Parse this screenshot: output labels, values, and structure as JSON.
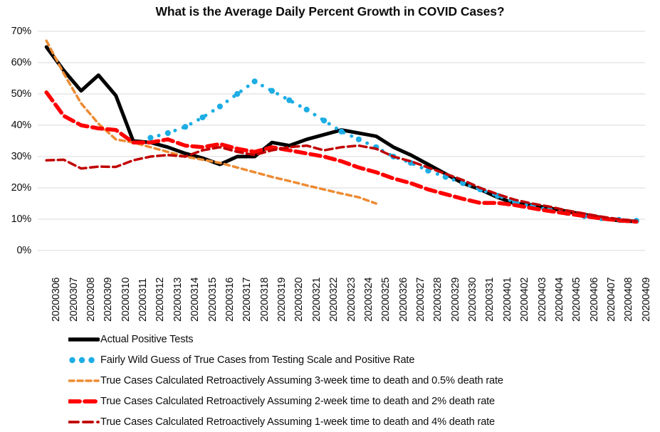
{
  "chart_data": {
    "type": "line",
    "title": "What is the Average Daily Percent Growth in COVID Cases?",
    "xlabel": "",
    "ylabel": "",
    "ylim": [
      0,
      0.7
    ],
    "ytick_labels": [
      "0%",
      "10%",
      "20%",
      "30%",
      "40%",
      "50%",
      "60%",
      "70%"
    ],
    "ytick_values": [
      0,
      0.1,
      0.2,
      0.3,
      0.4,
      0.5,
      0.6,
      0.7
    ],
    "grid": "horizontal",
    "legend_position": "bottom-left",
    "categories": [
      "20200306",
      "20200307",
      "20200308",
      "20200309",
      "20200310",
      "20200311",
      "20200312",
      "20200313",
      "20200314",
      "20200315",
      "20200316",
      "20200317",
      "20200318",
      "20200319",
      "20200320",
      "20200321",
      "20200322",
      "20200323",
      "20200324",
      "20200325",
      "20200326",
      "20200327",
      "20200328",
      "20200329",
      "20200330",
      "20200331",
      "20200401",
      "20200402",
      "20200403",
      "20200404",
      "20200405",
      "20200406",
      "20200407",
      "20200408",
      "20200409"
    ],
    "series": [
      {
        "name": "Actual Positive Tests",
        "color": "#000000",
        "style": "solid",
        "width": 5,
        "marker": "none",
        "values": [
          0.65,
          0.575,
          0.51,
          0.56,
          0.495,
          0.35,
          0.345,
          0.33,
          0.31,
          0.295,
          0.275,
          0.3,
          0.3,
          0.345,
          0.335,
          0.355,
          0.37,
          0.385,
          0.375,
          0.365,
          0.33,
          0.305,
          0.275,
          0.245,
          0.215,
          0.195,
          0.17,
          0.15,
          0.145,
          0.135,
          0.125,
          0.115,
          0.105,
          0.095,
          0.093
        ]
      },
      {
        "name": "Fairly Wild Guess of True Cases from Testing Scale and Positive Rate",
        "color": "#1CADE4",
        "style": "dotted",
        "width": 5,
        "marker": "circle",
        "values": [
          null,
          null,
          null,
          null,
          null,
          null,
          0.36,
          0.375,
          0.395,
          0.425,
          0.46,
          0.5,
          0.54,
          0.51,
          0.48,
          0.45,
          0.415,
          0.38,
          0.355,
          0.33,
          0.3,
          0.28,
          0.255,
          0.235,
          0.215,
          0.195,
          0.175,
          0.155,
          0.14,
          0.13,
          0.12,
          0.11,
          0.103,
          0.098,
          0.095
        ]
      },
      {
        "name": "True Cases Calculated Retroactively Assuming 3-week time to death and 0.5% death rate",
        "color": "#ED8B33",
        "style": "dashed-small",
        "width": 3.5,
        "marker": "none",
        "values": [
          0.67,
          0.565,
          0.47,
          0.405,
          0.355,
          0.345,
          0.33,
          0.315,
          0.3,
          0.29,
          0.28,
          0.265,
          0.25,
          0.235,
          0.222,
          0.208,
          0.195,
          0.182,
          0.17,
          0.15,
          null,
          null,
          null,
          null,
          null,
          null,
          null,
          null,
          null,
          null,
          null,
          null,
          null,
          null,
          null
        ]
      },
      {
        "name": "True Cases Calculated Retroactively Assuming 2-week time to death and 2% death rate",
        "color": "#FF0000",
        "style": "dashed-large",
        "width": 5.5,
        "marker": "none",
        "values": [
          0.505,
          0.43,
          0.4,
          0.39,
          0.385,
          0.345,
          0.345,
          0.355,
          0.335,
          0.33,
          0.34,
          0.325,
          0.315,
          0.33,
          0.32,
          0.31,
          0.3,
          0.285,
          0.265,
          0.25,
          0.23,
          0.215,
          0.195,
          0.18,
          0.165,
          0.152,
          0.152,
          0.145,
          0.135,
          0.126,
          0.118,
          0.11,
          0.102,
          0.096,
          0.092
        ]
      },
      {
        "name": "True Cases Calculated Retroactively Assuming 1-week time to death and 4% death rate",
        "color": "#C00000",
        "style": "dashed-med",
        "width": 3.5,
        "marker": "none",
        "values": [
          0.288,
          0.29,
          0.262,
          0.268,
          0.267,
          0.288,
          0.3,
          0.305,
          0.3,
          0.32,
          0.33,
          0.315,
          0.305,
          0.32,
          0.33,
          0.335,
          0.32,
          0.33,
          0.335,
          0.325,
          0.3,
          0.285,
          0.265,
          0.245,
          0.225,
          0.2,
          0.18,
          0.162,
          0.15,
          0.14,
          0.128,
          0.118,
          0.108,
          0.1,
          0.095
        ]
      }
    ]
  },
  "legend": {
    "items": [
      {
        "label": "Actual Positive Tests",
        "swatch": "solid-black-line"
      },
      {
        "label": "Fairly Wild Guess of True Cases from Testing Scale and Positive Rate",
        "swatch": "dotted-blue-line"
      },
      {
        "label": "True Cases Calculated Retroactively Assuming 3-week time to death and 0.5% death rate",
        "swatch": "dashed-orange-line"
      },
      {
        "label": "True Cases Calculated Retroactively Assuming 2-week time to death and 2% death rate",
        "swatch": "dashed-red-line"
      },
      {
        "label": "True Cases Calculated Retroactively Assuming 1-week time to death and 4% death rate",
        "swatch": "dashed-darkred-line"
      }
    ]
  },
  "colors": {
    "actual": "#000000",
    "guess": "#1CADE4",
    "three_week": "#ED8B33",
    "two_week": "#FF0000",
    "one_week": "#C00000",
    "gridline": "#D9D9D9",
    "text": "#0D0D0D"
  }
}
